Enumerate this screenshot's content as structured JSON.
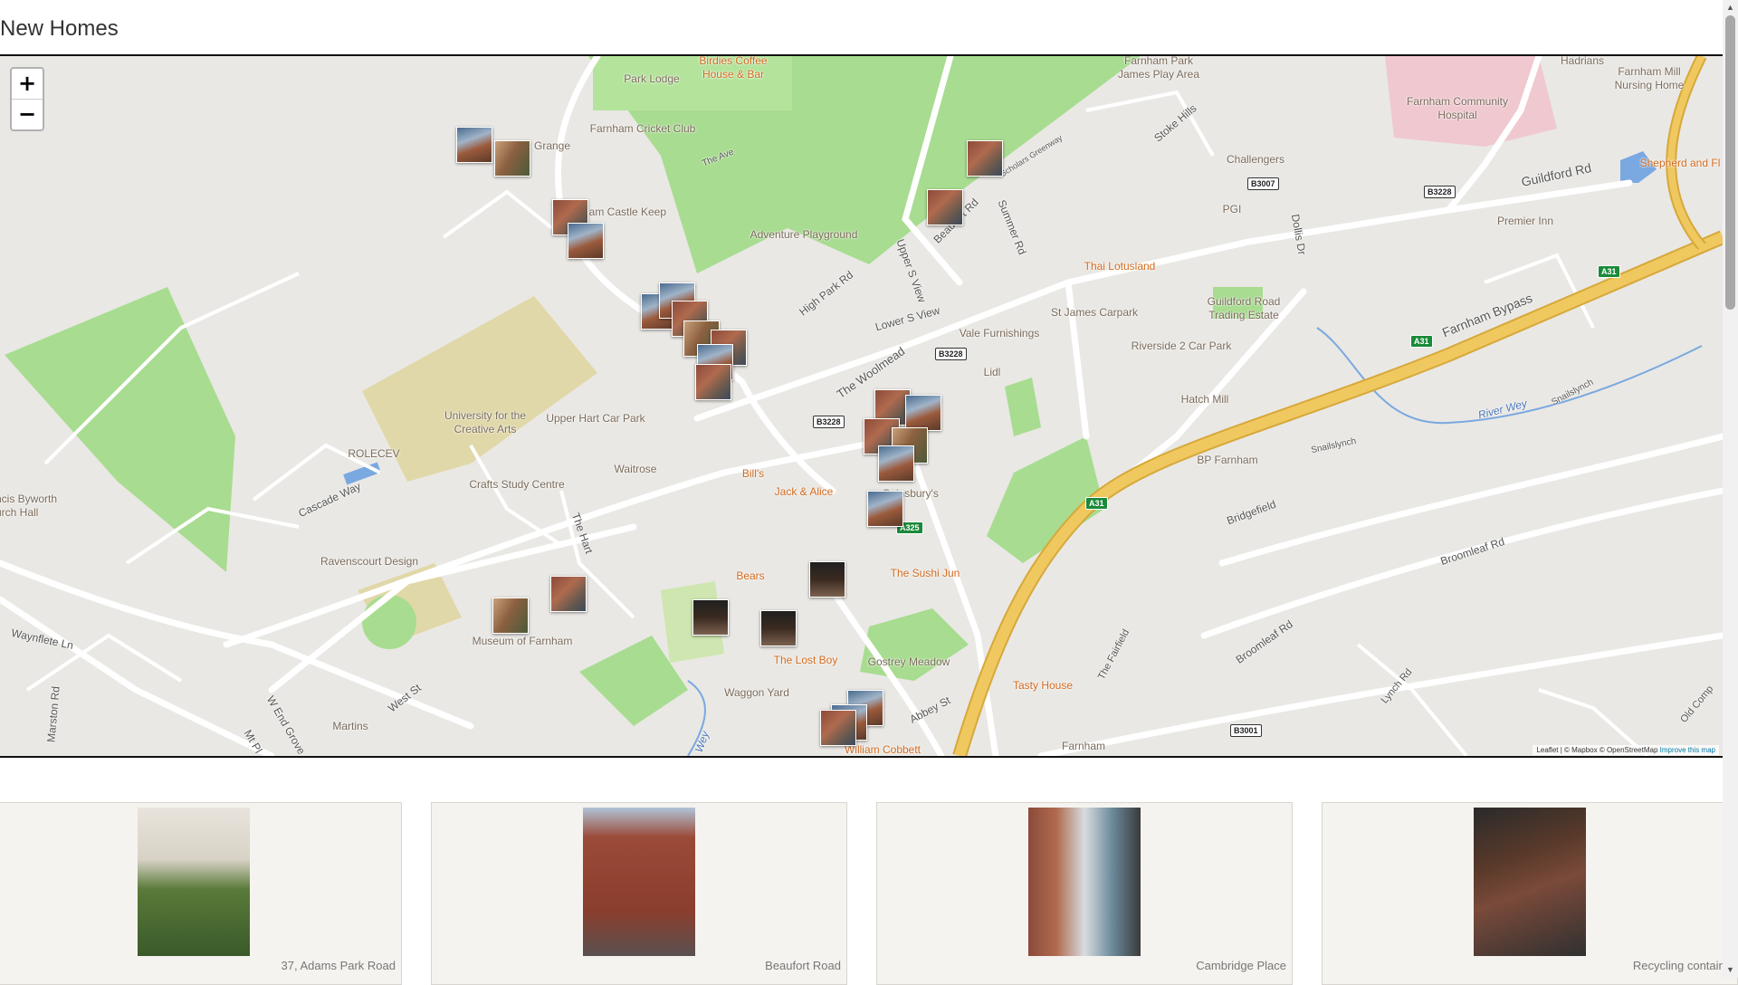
{
  "page": {
    "title": "New Homes"
  },
  "map": {
    "zoom_in_label": "+",
    "zoom_out_label": "−",
    "attribution": {
      "leaflet": "Leaflet",
      "sep": " | © Mapbox © OpenStreetMap ",
      "improve": "Improve this map"
    },
    "pois": [
      {
        "name": "Park Lodge",
        "style": "grey"
      },
      {
        "name": "Birdies Coffee House & Bar",
        "style": "orange"
      },
      {
        "name": "Farnham Cricket Club",
        "style": "grey"
      },
      {
        "name": "Grange",
        "style": "grey"
      },
      {
        "name": "nam Castle Keep",
        "style": "grey"
      },
      {
        "name": "Adventure Playground",
        "style": "grey"
      },
      {
        "name": "Farnham Park James Play Area",
        "style": "grey"
      },
      {
        "name": "Hadrians",
        "style": "grey"
      },
      {
        "name": "Farnham Mill Nursing Home",
        "style": "grey"
      },
      {
        "name": "Farnham Community Hospital",
        "style": "grey"
      },
      {
        "name": "Shepherd and Fl",
        "style": "orange"
      },
      {
        "name": "Challengers",
        "style": "grey"
      },
      {
        "name": "PGI",
        "style": "grey"
      },
      {
        "name": "Premier Inn",
        "style": "grey"
      },
      {
        "name": "Thai Lotusland",
        "style": "orange"
      },
      {
        "name": "St James Carpark",
        "style": "grey"
      },
      {
        "name": "Guildford Road Trading Estate",
        "style": "grey"
      },
      {
        "name": "Vale Furnishings",
        "style": "grey"
      },
      {
        "name": "Riverside 2 Car Park",
        "style": "grey"
      },
      {
        "name": "Lidl",
        "style": "grey"
      },
      {
        "name": "Hatch Mill",
        "style": "grey"
      },
      {
        "name": "University for the Creative Arts",
        "style": "grey"
      },
      {
        "name": "Upper Hart Car Park",
        "style": "grey"
      },
      {
        "name": "ROLECEV",
        "style": "grey"
      },
      {
        "name": "Waitrose",
        "style": "grey"
      },
      {
        "name": "Crafts Study Centre",
        "style": "grey"
      },
      {
        "name": "Bill's",
        "style": "orange"
      },
      {
        "name": "Jack & Alice",
        "style": "orange"
      },
      {
        "name": "Sainsbury's",
        "style": "grey"
      },
      {
        "name": "BP Farnham",
        "style": "grey"
      },
      {
        "name": "ncis Byworth urch Hall",
        "style": "grey"
      },
      {
        "name": "Ravenscourt Design",
        "style": "grey"
      },
      {
        "name": "Bears",
        "style": "orange"
      },
      {
        "name": "The Sushi Jun",
        "style": "orange"
      },
      {
        "name": "Museum of Farnham",
        "style": "grey"
      },
      {
        "name": "The Lost Boy",
        "style": "orange"
      },
      {
        "name": "Gostrey Meadow",
        "style": "grey"
      },
      {
        "name": "Waggon Yard",
        "style": "grey"
      },
      {
        "name": "Tasty House",
        "style": "orange"
      },
      {
        "name": "Martins",
        "style": "grey"
      },
      {
        "name": "William Cobbett",
        "style": "orange"
      },
      {
        "name": "Farnham",
        "style": "grey"
      },
      {
        "name": "River Wey",
        "style": "blue"
      },
      {
        "name": "Wey",
        "style": "blue"
      }
    ],
    "roads": [
      "The Ave",
      "Stoke Hills",
      "Guildford Rd",
      "Beaufort Rd",
      "Summer Rd",
      "Upper S View",
      "Dollis Dr",
      "High Park Rd",
      "Lower S View",
      "The Woolmead",
      "Farnham Bypass",
      "Snailslynch",
      "Cascade Way",
      "The Hart",
      "Bridgefield",
      "Broomleaf Rd",
      "Waynflete Ln",
      "Marston Rd",
      "W End Grove",
      "Mt Pl",
      "West St",
      "Abbey St",
      "The Fairfield",
      "Lynch Rd",
      "Old Comp",
      "Scholars Greenway"
    ],
    "shields": [
      "B3007",
      "B3228",
      "A31",
      "B3228",
      "B3228",
      "A325",
      "B3001"
    ]
  },
  "listings": [
    {
      "caption": "37, Adams Park Road"
    },
    {
      "caption": "Beaufort Road"
    },
    {
      "caption": "Cambridge Place"
    },
    {
      "caption": "Recycling containe"
    }
  ],
  "colors": {
    "park": "#a8dc90",
    "road_major": "#f0c860",
    "water": "#7aa8e0",
    "university": "#e0d8a8",
    "hospital": "#f0c8d0"
  }
}
